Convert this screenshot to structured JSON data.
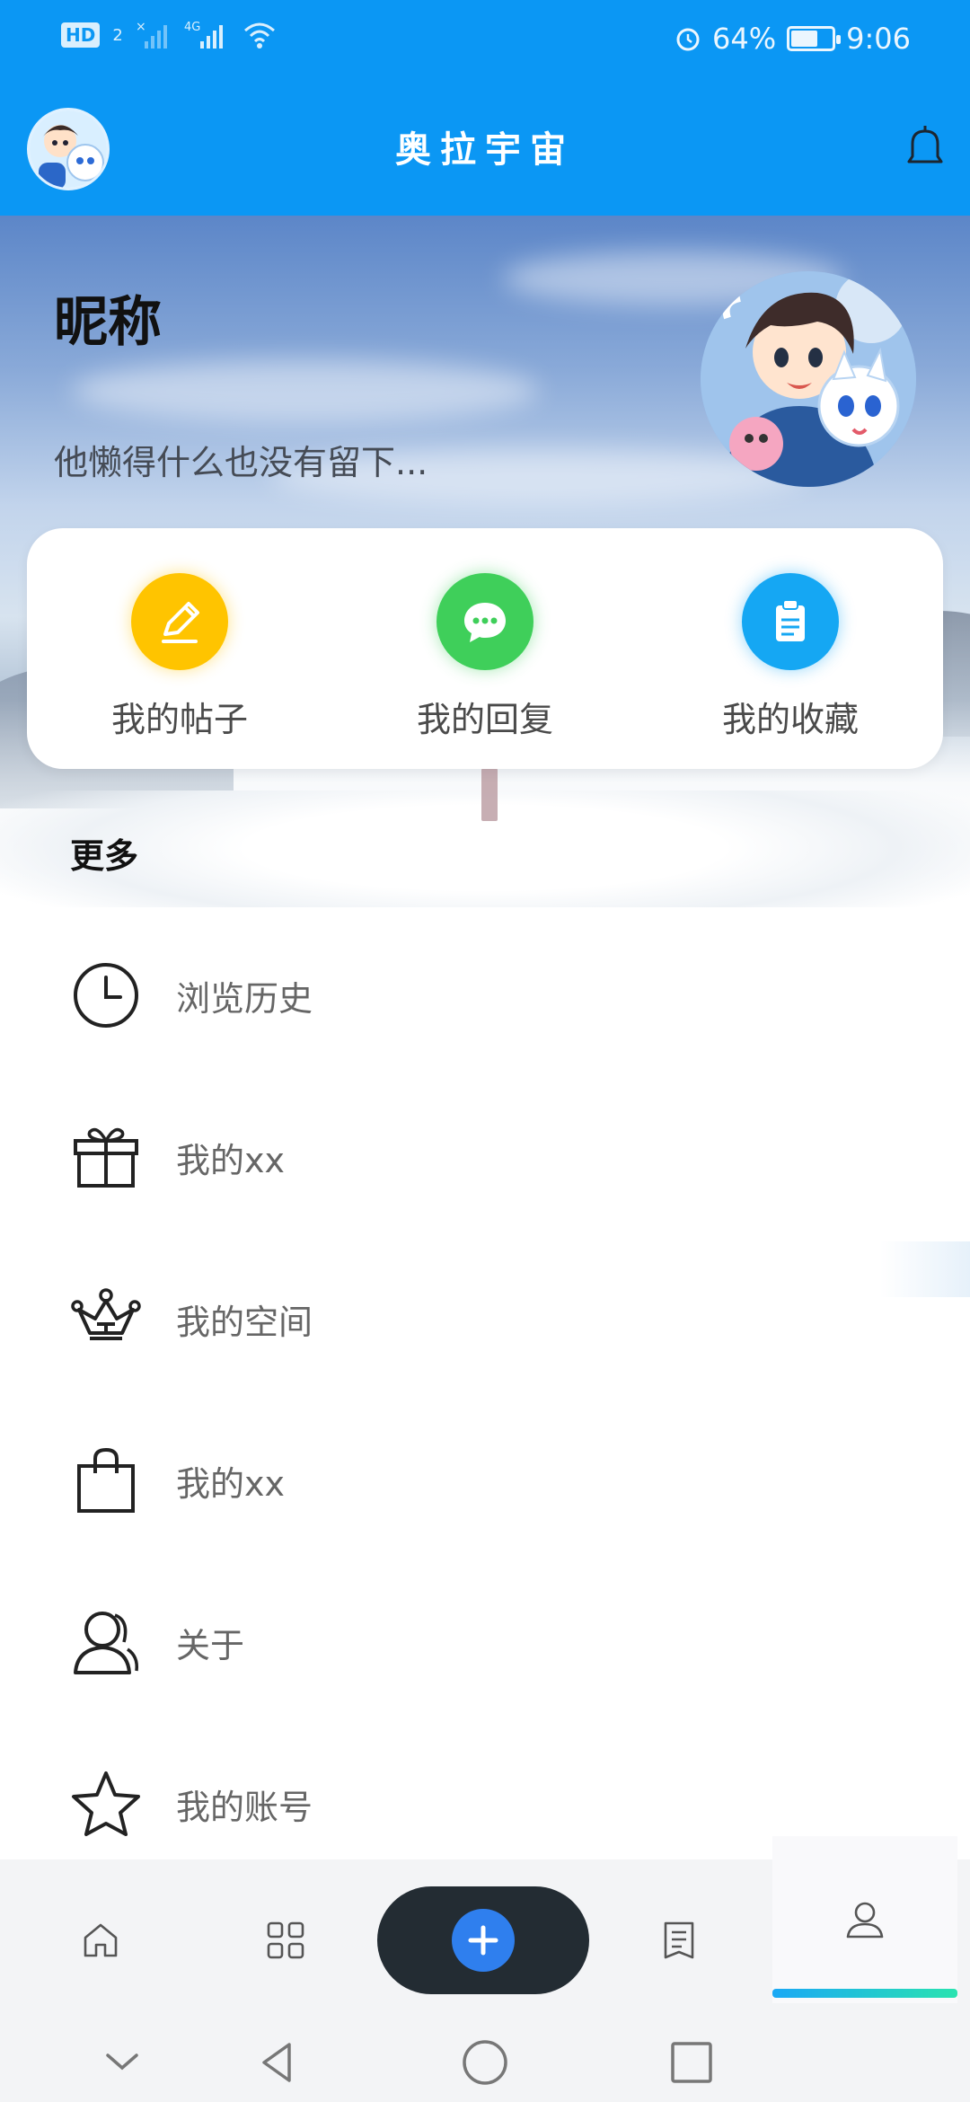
{
  "status_bar": {
    "left_badges": [
      "HD",
      "2",
      "×",
      "4G"
    ],
    "battery_percent_text": "64%",
    "battery_level": 0.64,
    "time": "9:06"
  },
  "header": {
    "title": "奥拉宇宙",
    "bell_icon": "bell-icon"
  },
  "profile": {
    "nickname": "昵称",
    "bio": "他懒得什么也没有留下..."
  },
  "quick_actions": [
    {
      "label": "我的帖子",
      "icon": "pencil-icon",
      "color": "#ffc400"
    },
    {
      "label": "我的回复",
      "icon": "chat-bubble-icon",
      "color": "#3fcf5a"
    },
    {
      "label": "我的收藏",
      "icon": "clipboard-icon",
      "color": "#15a7f3"
    }
  ],
  "more_section": {
    "title": "更多",
    "items": [
      {
        "label": "浏览历史",
        "icon": "clock-icon"
      },
      {
        "label": "我的xx",
        "icon": "gift-icon"
      },
      {
        "label": "我的空间",
        "icon": "crown-icon"
      },
      {
        "label": "我的xx",
        "icon": "shopping-bag-icon"
      },
      {
        "label": "关于",
        "icon": "person-icon"
      },
      {
        "label": "我的账号",
        "icon": "star-icon"
      }
    ]
  },
  "tabbar": {
    "tabs": [
      "home-icon",
      "grid-icon",
      "add-icon",
      "notes-icon",
      "profile-icon"
    ],
    "active_tab": "profile-icon",
    "accent_gradient": [
      "#1aa8f5",
      "#29e3b0"
    ]
  },
  "colors": {
    "primary": "#0b97f4",
    "add_button": "#2f7fee"
  }
}
